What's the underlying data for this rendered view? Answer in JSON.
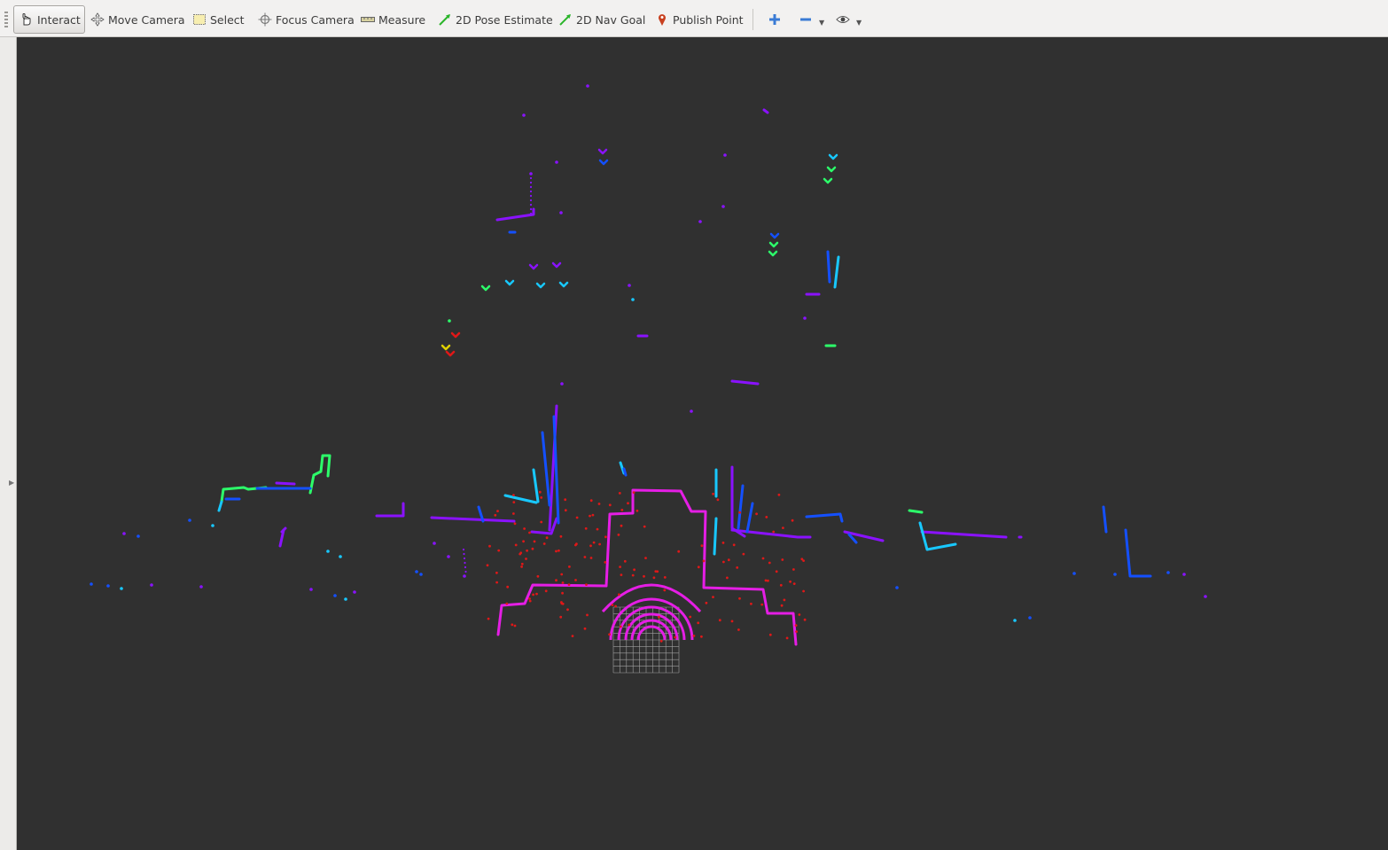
{
  "toolbar": {
    "tools": [
      {
        "label": "Interact",
        "icon": "hand-pointer-icon",
        "active": true
      },
      {
        "label": "Move Camera",
        "icon": "move-camera-icon"
      },
      {
        "label": "Select",
        "icon": "select-box-icon"
      },
      {
        "label": "Focus Camera",
        "icon": "focus-crosshair-icon"
      },
      {
        "label": "Measure",
        "icon": "ruler-icon"
      },
      {
        "label": "2D Pose Estimate",
        "icon": "green-arrow-icon"
      },
      {
        "label": "2D Nav Goal",
        "icon": "green-arrow-icon"
      },
      {
        "label": "Publish Point",
        "icon": "map-pin-icon"
      }
    ],
    "extra": [
      {
        "icon": "plus-icon"
      },
      {
        "icon": "minus-icon"
      },
      {
        "icon": "eye-icon"
      }
    ]
  },
  "colors": {
    "viewport_bg": "#303030",
    "laser_magenta": "#e51ee5",
    "laser_purple": "#8a12ff",
    "laser_blue": "#1450ff",
    "laser_cyan": "#18c8ff",
    "laser_green": "#2cff6a",
    "points_red": "#e01818",
    "grid": "#a0a0a0"
  }
}
